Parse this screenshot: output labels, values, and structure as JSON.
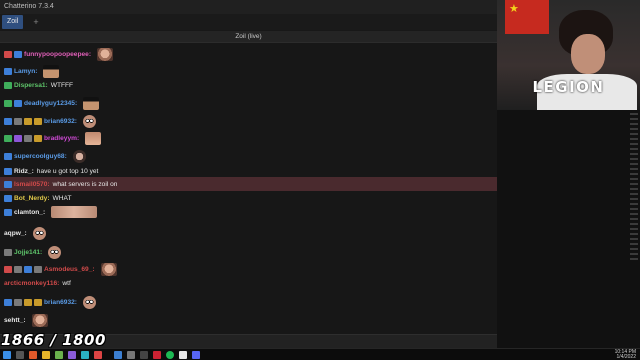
{
  "app": {
    "window_title": "Chatterino 7.3.4",
    "tab_label": "Zoil",
    "tab_add": "+",
    "channel_title": "Zoil (live)"
  },
  "overlay": {
    "score": "1866 / 1800",
    "brand": "LEGION"
  },
  "colors": {
    "tab_active": "#2f4f7f",
    "highlight_row": "#4a2a2e",
    "flag": "#c62a1f"
  },
  "messages": [
    {
      "user": "funnypoopoopeepee:",
      "user_color": "#e05fb8",
      "text": "",
      "badges": [
        "red",
        "blue"
      ],
      "emote": "e-face"
    },
    {
      "user": "Lamyn:",
      "user_color": "#5a9be6",
      "text": "",
      "badges": [
        "blue"
      ],
      "emote": "e-hat"
    },
    {
      "user": "Dispersa1:",
      "user_color": "#5ec46a",
      "text": "WTFFF",
      "badges": [
        "green"
      ],
      "emote": ""
    },
    {
      "user": "deadlyguy12345:",
      "user_color": "#5a9be6",
      "text": "",
      "badges": [
        "green",
        "blue"
      ],
      "emote": "e-hat"
    },
    {
      "user": "brian6932:",
      "user_color": "#5a9be6",
      "text": "",
      "badges": [
        "blue",
        "gray",
        "gold",
        "gold"
      ],
      "emote": "e-eyes"
    },
    {
      "user": "bradleyym:",
      "user_color": "#d04ad6",
      "text": "",
      "badges": [
        "green",
        "purple",
        "gray",
        "gold"
      ],
      "emote": "e-smile"
    },
    {
      "user": "supercoolguy68:",
      "user_color": "#5a9be6",
      "text": "",
      "badges": [
        "blue"
      ],
      "emote": "e-round"
    },
    {
      "user": "Ridz_:",
      "user_color": "#e8e8e8",
      "text": "have u got top 10 yet",
      "badges": [
        "blue"
      ],
      "emote": ""
    },
    {
      "user": "Ismail0570:",
      "user_color": "#d04a4a",
      "text": "what servers is zoil on",
      "badges": [
        "blue"
      ],
      "emote": ""
    },
    {
      "user": "Bot_Nerdy:",
      "user_color": "#e0c84a",
      "text": "WHAT",
      "badges": [
        "blue"
      ],
      "emote": ""
    },
    {
      "user": "clamton_:",
      "user_color": "#e8e8e8",
      "text": "",
      "badges": [
        "blue"
      ],
      "emote": "e-wide"
    },
    {
      "user": "aqpw_:",
      "user_color": "#e8e8e8",
      "text": "",
      "badges": [],
      "emote": "e-eyes"
    },
    {
      "user": "Jojje141:",
      "user_color": "#5ec46a",
      "text": "",
      "badges": [
        "gray"
      ],
      "emote": "e-eyes"
    },
    {
      "user": "Asmodeus_69_:",
      "user_color": "#d04a4a",
      "text": "",
      "badges": [
        "red",
        "gray",
        "blue",
        "gray"
      ],
      "emote": "e-face"
    },
    {
      "user": "arcticmonkey116:",
      "user_color": "#d04a4a",
      "text": "wtf",
      "badges": [],
      "emote": ""
    },
    {
      "user": "brian6932:",
      "user_color": "#5a9be6",
      "text": "",
      "badges": [
        "blue",
        "gray",
        "gold",
        "gold"
      ],
      "emote": "e-eyes"
    },
    {
      "user": "sehtt_:",
      "user_color": "#e8e8e8",
      "text": "",
      "badges": [],
      "emote": "e-face"
    }
  ],
  "tray": {
    "time": "10:14 PM",
    "date": "1/4/2022"
  }
}
